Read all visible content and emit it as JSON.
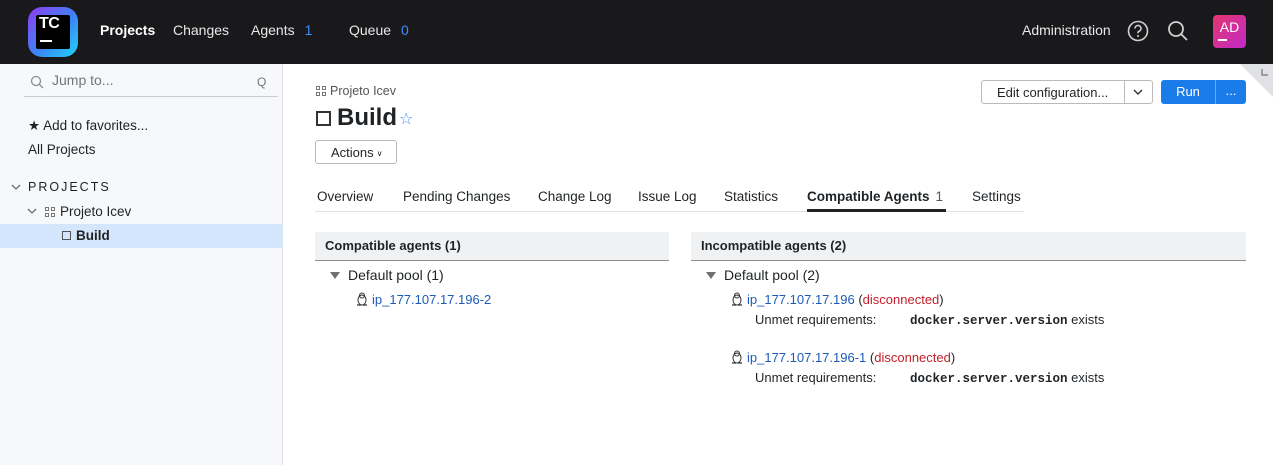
{
  "logo": {
    "text": "TC"
  },
  "topnav": {
    "projects": "Projects",
    "changes": "Changes",
    "agents": "Agents",
    "agents_count": "1",
    "queue": "Queue",
    "queue_count": "0",
    "administration": "Administration",
    "avatar": "AD"
  },
  "sidebar": {
    "jump_placeholder": "Jump to...",
    "jump_shortcut": "Q",
    "add_favorites": "★ Add to favorites...",
    "all_projects": "All Projects",
    "projects_header": "PROJECTS",
    "project_name": "Projeto Icev",
    "build_name": "Build"
  },
  "header": {
    "breadcrumb": "Projeto Icev",
    "title": "Build",
    "actions_label": "Actions",
    "edit_configuration": "Edit configuration...",
    "run": "Run",
    "more": "..."
  },
  "tabs": [
    {
      "label": "Overview"
    },
    {
      "label": "Pending Changes"
    },
    {
      "label": "Change Log"
    },
    {
      "label": "Issue Log"
    },
    {
      "label": "Statistics"
    },
    {
      "label": "Compatible Agents",
      "count": "1"
    },
    {
      "label": "Settings"
    }
  ],
  "compatible": {
    "header": "Compatible agents (1)",
    "pool": "Default pool (1)",
    "agents": [
      {
        "name": "ip_177.107.17.196-2"
      }
    ]
  },
  "incompatible": {
    "header": "Incompatible agents (2)",
    "pool": "Default pool (2)",
    "agents": [
      {
        "name": "ip_177.107.17.196",
        "status": "disconnected",
        "req_label": "Unmet requirements:",
        "req_param": "docker.server.version",
        "req_cond": "exists"
      },
      {
        "name": "ip_177.107.17.196-1",
        "status": "disconnected",
        "req_label": "Unmet requirements:",
        "req_param": "docker.server.version",
        "req_cond": "exists"
      }
    ]
  },
  "colors": {
    "accent": "#1a7ce8",
    "link": "#1d5bb8",
    "error": "#c4212a",
    "topbar": "#19191c"
  }
}
